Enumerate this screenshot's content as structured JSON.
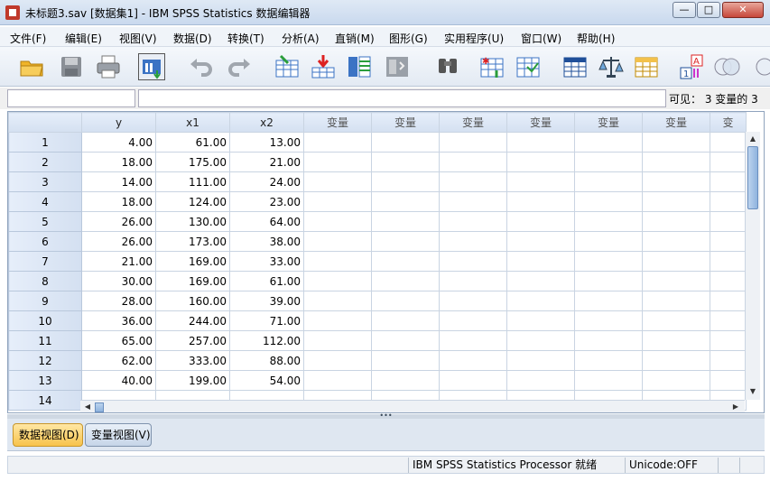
{
  "window": {
    "title": "未标题3.sav [数据集1] - IBM SPSS Statistics 数据编辑器",
    "minimize": "—",
    "maximize": "□",
    "close": "✕"
  },
  "menu": [
    "文件(F)",
    "编辑(E)",
    "视图(V)",
    "数据(D)",
    "转换(T)",
    "分析(A)",
    "直销(M)",
    "图形(G)",
    "实用程序(U)",
    "窗口(W)",
    "帮助(H)"
  ],
  "toolbar": {
    "icons": [
      "open-icon",
      "save-icon",
      "print-icon",
      "dialog-recall-icon",
      "undo-icon",
      "redo-icon",
      "goto-case-icon",
      "goto-variable-icon",
      "variables-icon",
      "run-descriptive-icon",
      "find-icon",
      "insert-cases-icon",
      "insert-variable-icon",
      "split-file-icon",
      "weight-cases-icon",
      "select-cases-icon",
      "value-labels-icon",
      "use-sets-icon"
    ]
  },
  "editor": {
    "cell_reference": "",
    "cell_value": "",
    "visible_label": "可见： 3 变量的 3"
  },
  "grid": {
    "columns": [
      "y",
      "x1",
      "x2",
      "变量",
      "变量",
      "变量",
      "变量",
      "变量",
      "变量",
      "变"
    ],
    "rows": [
      {
        "n": "1",
        "y": "4.00",
        "x1": "61.00",
        "x2": "13.00"
      },
      {
        "n": "2",
        "y": "18.00",
        "x1": "175.00",
        "x2": "21.00"
      },
      {
        "n": "3",
        "y": "14.00",
        "x1": "111.00",
        "x2": "24.00"
      },
      {
        "n": "4",
        "y": "18.00",
        "x1": "124.00",
        "x2": "23.00"
      },
      {
        "n": "5",
        "y": "26.00",
        "x1": "130.00",
        "x2": "64.00"
      },
      {
        "n": "6",
        "y": "26.00",
        "x1": "173.00",
        "x2": "38.00"
      },
      {
        "n": "7",
        "y": "21.00",
        "x1": "169.00",
        "x2": "33.00"
      },
      {
        "n": "8",
        "y": "30.00",
        "x1": "169.00",
        "x2": "61.00"
      },
      {
        "n": "9",
        "y": "28.00",
        "x1": "160.00",
        "x2": "39.00"
      },
      {
        "n": "10",
        "y": "36.00",
        "x1": "244.00",
        "x2": "71.00"
      },
      {
        "n": "11",
        "y": "65.00",
        "x1": "257.00",
        "x2": "112.00"
      },
      {
        "n": "12",
        "y": "62.00",
        "x1": "333.00",
        "x2": "88.00"
      },
      {
        "n": "13",
        "y": "40.00",
        "x1": "199.00",
        "x2": "54.00"
      },
      {
        "n": "14",
        "y": "",
        "x1": "",
        "x2": ""
      }
    ]
  },
  "tabs": {
    "data_view": "数据视图(D)",
    "variable_view": "变量视图(V)"
  },
  "status": {
    "processor": "IBM SPSS Statistics Processor 就绪",
    "unicode": "Unicode:OFF"
  },
  "colors": {
    "header_bg": "#d4e0f1",
    "active_tab": "#f7c34c",
    "accent": "#8fb3de"
  }
}
